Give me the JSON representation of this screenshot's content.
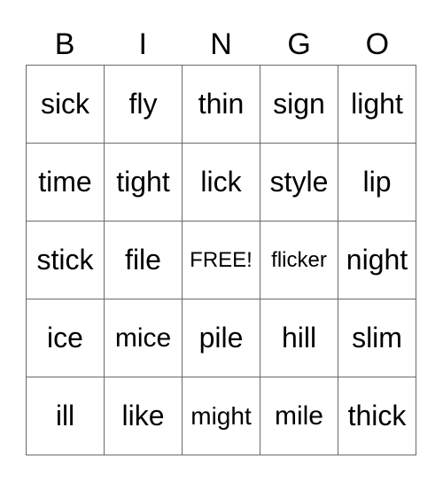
{
  "header": [
    "B",
    "I",
    "N",
    "G",
    "O"
  ],
  "cells": [
    [
      "sick",
      "fly",
      "thin",
      "sign",
      "light"
    ],
    [
      "time",
      "tight",
      "lick",
      "style",
      "lip"
    ],
    [
      "stick",
      "file",
      "FREE!",
      "flicker",
      "night"
    ],
    [
      "ice",
      "mice",
      "pile",
      "hill",
      "slim"
    ],
    [
      "ill",
      "like",
      "might",
      "mile",
      "thick"
    ]
  ],
  "border_color": "#6a6a6a"
}
